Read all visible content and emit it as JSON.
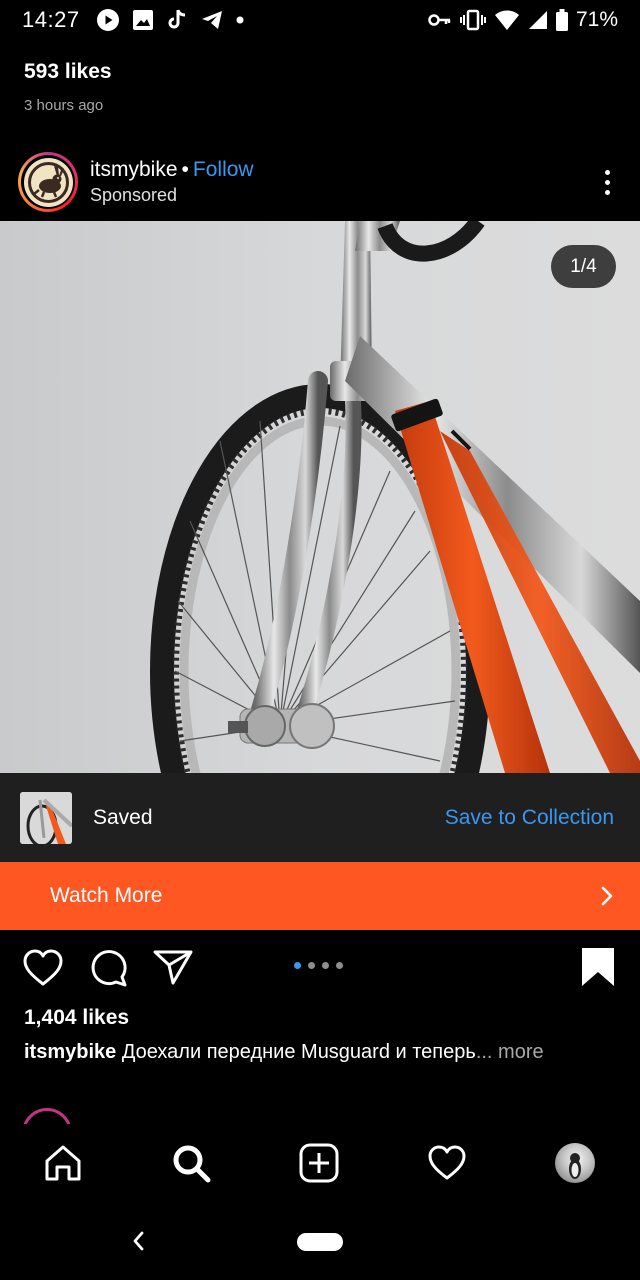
{
  "status_bar": {
    "time": "14:27",
    "battery": "71%",
    "left_icons": [
      "youtube-icon",
      "gallery-icon",
      "tiktok-icon",
      "telegram-icon",
      "notification-dot-icon"
    ],
    "right_icons": [
      "vpn-key-icon",
      "vibrate-icon",
      "wifi-icon",
      "signal-icon",
      "battery-icon"
    ]
  },
  "previous_post": {
    "likes": "593 likes",
    "time": "3 hours ago"
  },
  "post": {
    "username": "itsmybike",
    "separator": "•",
    "follow_label": "Follow",
    "sponsored_label": "Sponsored",
    "image_counter": "1/4",
    "saved_label": "Saved",
    "save_to_collection_label": "Save to Collection",
    "cta_label": "Watch More",
    "carousel": {
      "total": 4,
      "active": 1
    },
    "likes": "1,404 likes",
    "caption_user": "itsmybike",
    "caption_text": "Доехали передние Musguard и теперь",
    "caption_more": "... more",
    "accent_color": "#3897f0",
    "cta_color": "#ff5722"
  },
  "bottom_nav": {
    "items": [
      "home-icon",
      "search-icon",
      "add-post-icon",
      "activity-heart-icon",
      "profile-avatar"
    ]
  }
}
